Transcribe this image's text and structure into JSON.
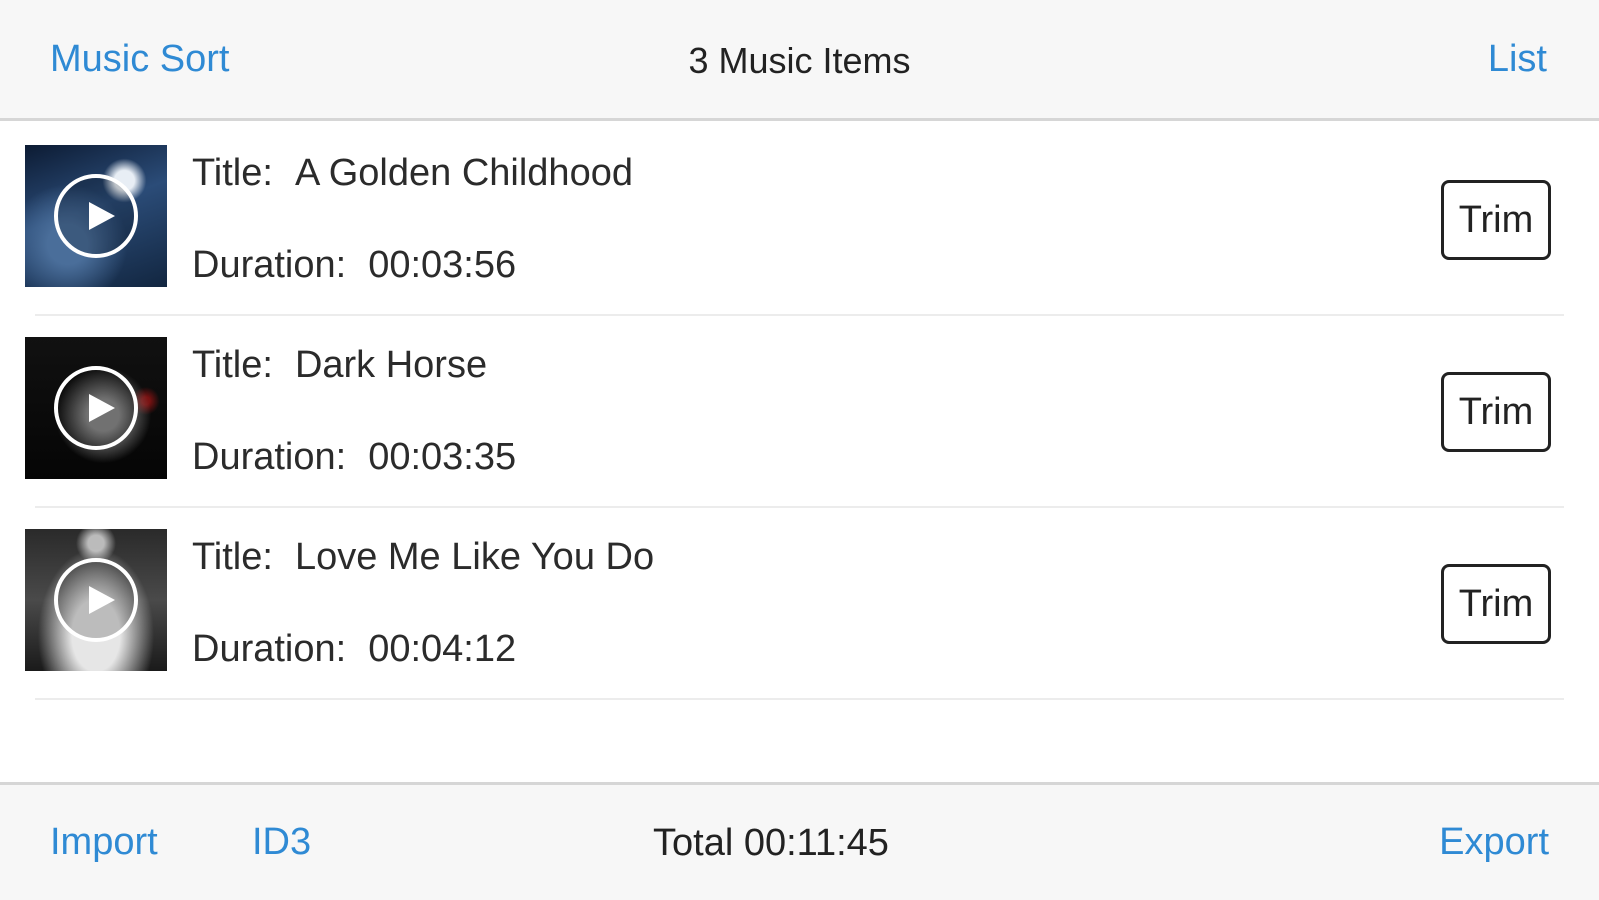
{
  "navbar": {
    "left_button": "Music Sort",
    "title": "3 Music Items",
    "right_button": "List"
  },
  "labels": {
    "title": "Title:",
    "duration": "Duration:",
    "trim": "Trim"
  },
  "items": [
    {
      "title": "A Golden Childhood",
      "duration": "00:03:56"
    },
    {
      "title": "Dark Horse",
      "duration": "00:03:35"
    },
    {
      "title": "Love Me Like You Do",
      "duration": "00:04:12"
    }
  ],
  "toolbar": {
    "import": "Import",
    "id3": "ID3",
    "total": "Total 00:11:45",
    "export": "Export"
  },
  "colors": {
    "accent": "#2f8ad4",
    "bar_background": "#f7f7f7",
    "text": "#2b2b2b"
  },
  "icons": [
    "play-icon"
  ]
}
